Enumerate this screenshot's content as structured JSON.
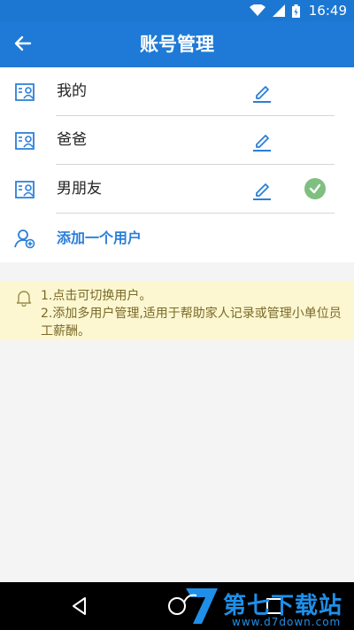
{
  "status_bar": {
    "time": "16:49"
  },
  "header": {
    "title": "账号管理",
    "back_icon": "arrow-left-icon"
  },
  "accounts": [
    {
      "name": "我的",
      "selected": false
    },
    {
      "name": "爸爸",
      "selected": false
    },
    {
      "name": "男朋友",
      "selected": true
    }
  ],
  "add_user": {
    "label": "添加一个用户"
  },
  "tips": {
    "line1": "1.点击可切换用户。",
    "line2": "2.添加多用户管理,适用于帮助家人记录或管理小单位员工薪酬。"
  },
  "watermark": {
    "text": "第七下载站",
    "url": "www.d7down.com"
  },
  "colors": {
    "primary": "#1e7ad6",
    "accent_text": "#2a7fd9",
    "tips_bg": "#fcf7d0",
    "check_green": "#7fbf7f"
  }
}
